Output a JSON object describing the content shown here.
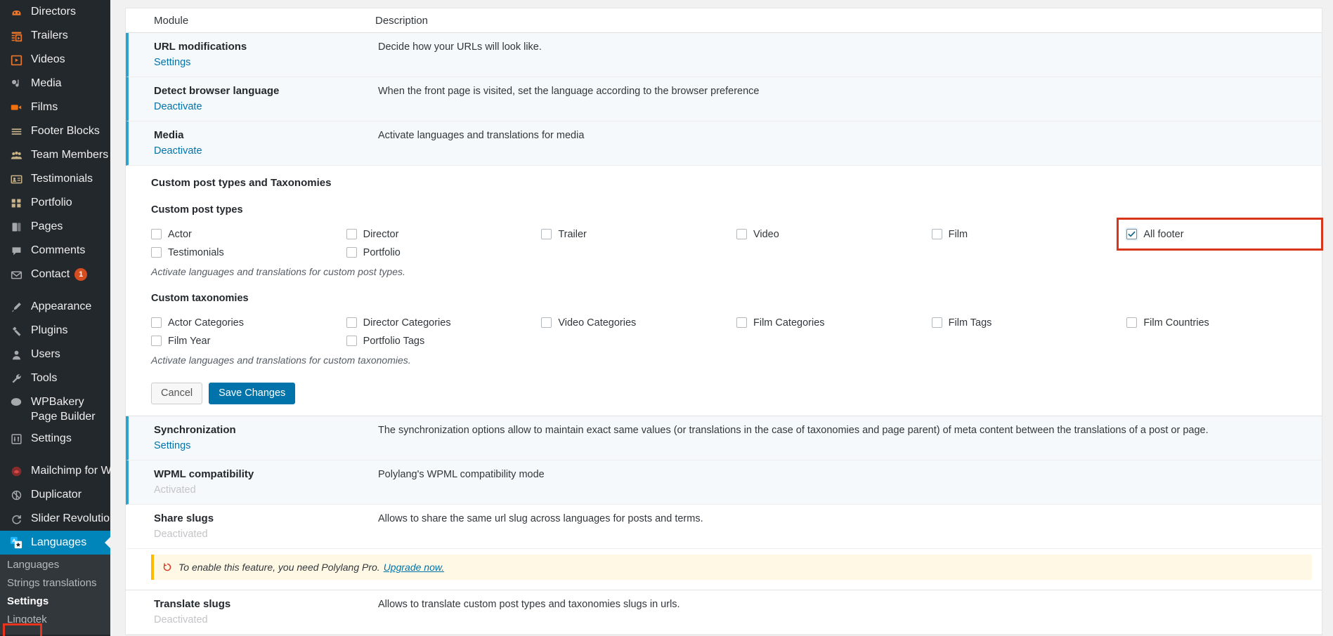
{
  "sidebar": {
    "items": [
      {
        "label": "Directors",
        "icon": "directors-icon",
        "badge": null
      },
      {
        "label": "Trailers",
        "icon": "trailers-icon",
        "badge": null
      },
      {
        "label": "Videos",
        "icon": "videos-icon",
        "badge": null
      },
      {
        "label": "Media",
        "icon": "media-icon",
        "badge": null
      },
      {
        "label": "Films",
        "icon": "films-icon",
        "badge": null
      },
      {
        "label": "Footer Blocks",
        "icon": "footer-blocks-icon",
        "badge": null
      },
      {
        "label": "Team Members",
        "icon": "team-members-icon",
        "badge": null
      },
      {
        "label": "Testimonials",
        "icon": "testimonials-icon",
        "badge": null
      },
      {
        "label": "Portfolio",
        "icon": "portfolio-icon",
        "badge": null
      },
      {
        "label": "Pages",
        "icon": "pages-icon",
        "badge": null
      },
      {
        "label": "Comments",
        "icon": "comments-icon",
        "badge": null
      },
      {
        "label": "Contact",
        "icon": "contact-icon",
        "badge": "1"
      },
      {
        "label": "Appearance",
        "icon": "appearance-icon",
        "badge": null
      },
      {
        "label": "Plugins",
        "icon": "plugins-icon",
        "badge": null
      },
      {
        "label": "Users",
        "icon": "users-icon",
        "badge": null
      },
      {
        "label": "Tools",
        "icon": "tools-icon",
        "badge": null
      },
      {
        "label": "WPBakery Page Builder",
        "icon": "wpbakery-icon",
        "badge": null
      },
      {
        "label": "Settings",
        "icon": "settings-icon",
        "badge": null
      },
      {
        "label": "Mailchimp for WP",
        "icon": "mailchimp-icon",
        "badge": null
      },
      {
        "label": "Duplicator",
        "icon": "duplicator-icon",
        "badge": null
      },
      {
        "label": "Slider Revolution",
        "icon": "slider-revolution-icon",
        "badge": null
      },
      {
        "label": "Languages",
        "icon": "languages-icon",
        "badge": null
      }
    ],
    "active_label": "Languages",
    "submenu": [
      {
        "label": "Languages",
        "current": false
      },
      {
        "label": "Strings translations",
        "current": false
      },
      {
        "label": "Settings",
        "current": true
      },
      {
        "label": "Lingotek",
        "current": false
      }
    ]
  },
  "table": {
    "headers": {
      "module": "Module",
      "description": "Description"
    },
    "rows_top": [
      {
        "title": "URL modifications",
        "action": "Settings",
        "action_state": "link",
        "description": "Decide how your URLs will look like."
      },
      {
        "title": "Detect browser language",
        "action": "Deactivate",
        "action_state": "link",
        "description": "When the front page is visited, set the language according to the browser preference"
      },
      {
        "title": "Media",
        "action": "Deactivate",
        "action_state": "link",
        "description": "Activate languages and translations for media"
      }
    ],
    "rows_bottom": [
      {
        "title": "Synchronization",
        "action": "Settings",
        "action_state": "link",
        "description": "The synchronization options allow to maintain exact same values (or translations in the case of taxonomies and page parent) of meta content between the translations of a post or page."
      },
      {
        "title": "WPML compatibility",
        "action": "Activated",
        "action_state": "disabled",
        "description": "Polylang's WPML compatibility mode"
      },
      {
        "title": "Share slugs",
        "action": "Deactivated",
        "action_state": "disabled",
        "description": "Allows to share the same url slug across languages for posts and terms."
      },
      {
        "title": "Translate slugs",
        "action": "Deactivated",
        "action_state": "disabled",
        "description": "Allows to translate custom post types and taxonomies slugs in urls."
      }
    ]
  },
  "expanded_panel": {
    "title": "Custom post types and Taxonomies",
    "post_types_label": "Custom post types",
    "post_types": [
      {
        "label": "Actor",
        "checked": false
      },
      {
        "label": "Director",
        "checked": false
      },
      {
        "label": "Trailer",
        "checked": false
      },
      {
        "label": "Video",
        "checked": false
      },
      {
        "label": "Film",
        "checked": false
      },
      {
        "label": "All footer",
        "checked": true
      },
      {
        "label": "Testimonials",
        "checked": false
      },
      {
        "label": "Portfolio",
        "checked": false
      }
    ],
    "post_types_hint": "Activate languages and translations for custom post types.",
    "taxonomies_label": "Custom taxonomies",
    "taxonomies": [
      {
        "label": "Actor Categories",
        "checked": false
      },
      {
        "label": "Director Categories",
        "checked": false
      },
      {
        "label": "Video Categories",
        "checked": false
      },
      {
        "label": "Film Categories",
        "checked": false
      },
      {
        "label": "Film Tags",
        "checked": false
      },
      {
        "label": "Film Countries",
        "checked": false
      },
      {
        "label": "Film Year",
        "checked": false
      },
      {
        "label": "Portfolio Tags",
        "checked": false
      }
    ],
    "taxonomies_hint": "Activate languages and translations for custom taxonomies.",
    "cancel_label": "Cancel",
    "save_label": "Save Changes"
  },
  "notice": {
    "text": "To enable this feature, you need Polylang Pro.",
    "link_label": "Upgrade now.",
    "icon": "polylang-icon"
  },
  "colors": {
    "sidebar_bg": "#23282d",
    "submenu_bg": "#32373c",
    "active_blue": "#0085ba",
    "link_blue": "#0073aa",
    "row_accent": "#2EA2CC",
    "annotation_red": "#d8351b",
    "notice_bg": "#fff8e5",
    "notice_border": "#ffb900",
    "badge_orange": "#d54e21"
  }
}
